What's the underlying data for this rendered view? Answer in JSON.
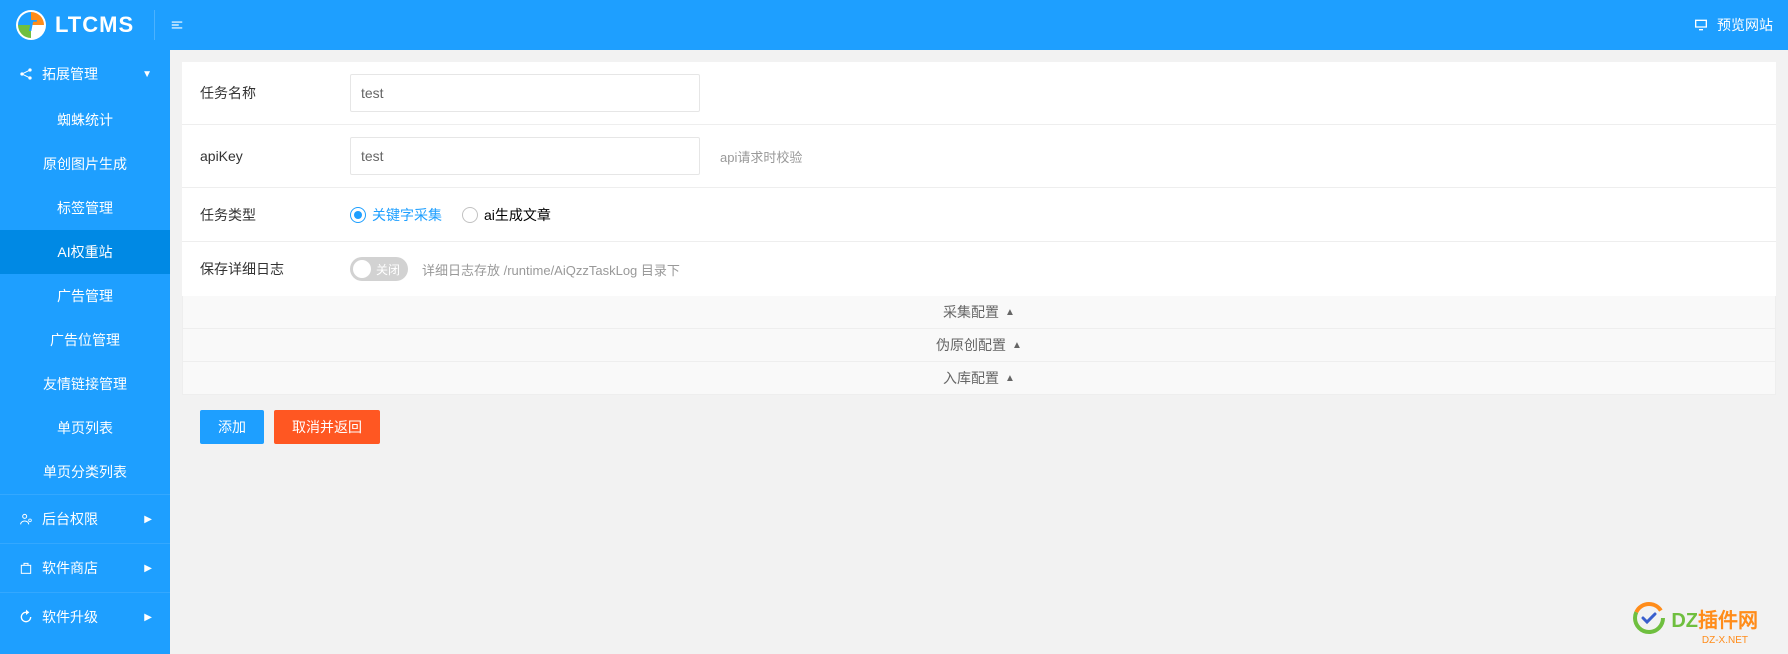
{
  "header": {
    "logo_text": "LTCMS",
    "preview_label": "预览网站"
  },
  "sidebar": {
    "groups": [
      {
        "label": "拓展管理",
        "expanded": true,
        "icon": "share"
      },
      {
        "label": "后台权限",
        "expanded": false,
        "icon": "user-key"
      },
      {
        "label": "软件商店",
        "expanded": false,
        "icon": "package"
      },
      {
        "label": "软件升级",
        "expanded": false,
        "icon": "refresh"
      }
    ],
    "items": [
      {
        "label": "蜘蛛统计",
        "active": false
      },
      {
        "label": "原创图片生成",
        "active": false
      },
      {
        "label": "标签管理",
        "active": false
      },
      {
        "label": "AI权重站",
        "active": true
      },
      {
        "label": "广告管理",
        "active": false
      },
      {
        "label": "广告位管理",
        "active": false
      },
      {
        "label": "友情链接管理",
        "active": false
      },
      {
        "label": "单页列表",
        "active": false
      },
      {
        "label": "单页分类列表",
        "active": false
      }
    ]
  },
  "form": {
    "fields": {
      "task_name": {
        "label": "任务名称",
        "value": "test"
      },
      "api_key": {
        "label": "apiKey",
        "value": "test",
        "hint": "api请求时校验"
      },
      "task_type": {
        "label": "任务类型",
        "options": [
          {
            "label": "关键字采集",
            "checked": true
          },
          {
            "label": "ai生成文章",
            "checked": false
          }
        ]
      },
      "save_log": {
        "label": "保存详细日志",
        "switch_text": "关闭",
        "hint": "详细日志存放 /runtime/AiQzzTaskLog 目录下"
      }
    },
    "sections": [
      {
        "label": "采集配置"
      },
      {
        "label": "伪原创配置"
      },
      {
        "label": "入库配置"
      }
    ],
    "actions": {
      "submit": "添加",
      "cancel": "取消并返回"
    }
  },
  "watermark": {
    "text": "DZ插件网",
    "sub": "DZ-X.NET"
  }
}
